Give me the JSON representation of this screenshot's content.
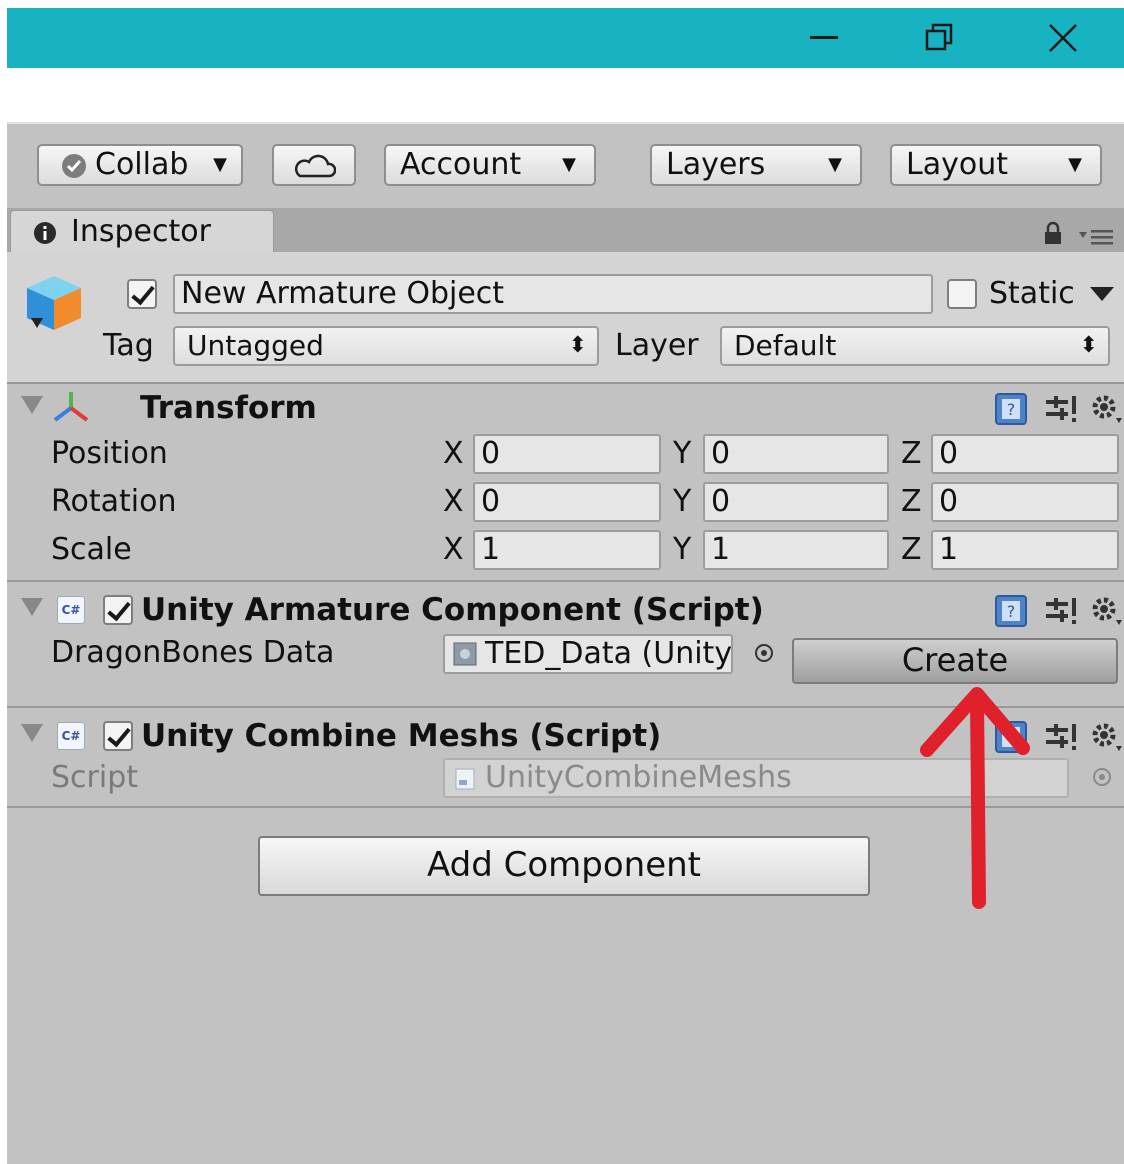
{
  "toolbar": {
    "collab_label": "Collab",
    "account_label": "Account",
    "layers_label": "Layers",
    "layout_label": "Layout"
  },
  "inspector": {
    "tab_label": "Inspector",
    "object": {
      "active": true,
      "name": "New Armature Object",
      "static_label": "Static",
      "static_checked": false,
      "tag_label": "Tag",
      "tag_value": "Untagged",
      "layer_label": "Layer",
      "layer_value": "Default"
    },
    "transform": {
      "title": "Transform",
      "rows": [
        {
          "label": "Position",
          "x": "0",
          "y": "0",
          "z": "0"
        },
        {
          "label": "Rotation",
          "x": "0",
          "y": "0",
          "z": "0"
        },
        {
          "label": "Scale",
          "x": "1",
          "y": "1",
          "z": "1"
        }
      ],
      "axis_labels": [
        "X",
        "Y",
        "Z"
      ]
    },
    "armature_component": {
      "title": "Unity Armature Component (Script)",
      "field_label": "DragonBones Data",
      "field_value": "TED_Data (Unity",
      "create_label": "Create"
    },
    "combine_meshs": {
      "title": "Unity Combine Meshs (Script)",
      "script_label": "Script",
      "script_value": "UnityCombineMeshs"
    },
    "add_component_label": "Add Component"
  },
  "colors": {
    "titlebar": "#17b3c1",
    "annotation_arrow": "#e0202a"
  }
}
